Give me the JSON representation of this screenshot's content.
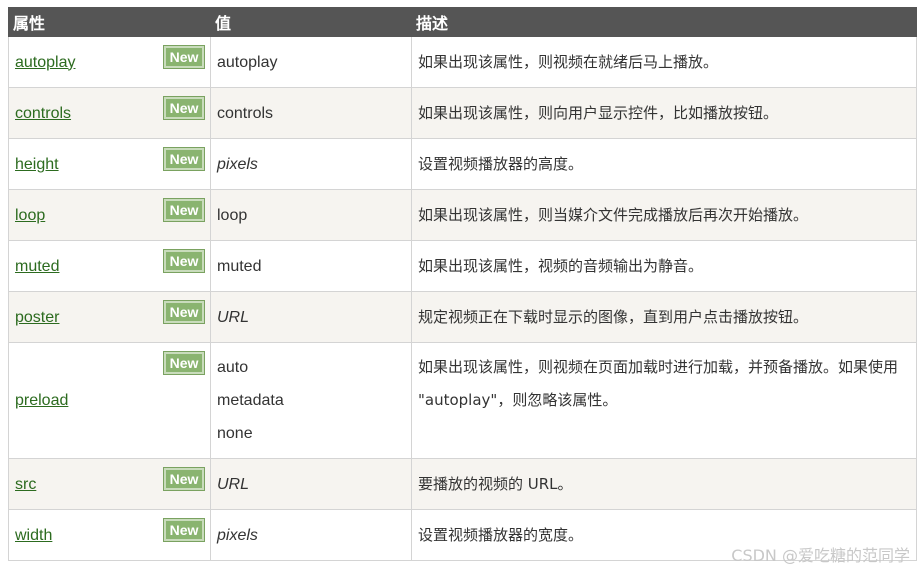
{
  "header": {
    "col_attribute": "属性",
    "col_value": "值",
    "col_description": "描述"
  },
  "badge_label": "New",
  "rows": [
    {
      "name": "autoplay",
      "values": [
        "autoplay"
      ],
      "italic": false,
      "description": "如果出现该属性，则视频在就绪后马上播放。"
    },
    {
      "name": "controls",
      "values": [
        "controls"
      ],
      "italic": false,
      "description": "如果出现该属性，则向用户显示控件，比如播放按钮。"
    },
    {
      "name": "height",
      "values": [
        "pixels"
      ],
      "italic": true,
      "description": "设置视频播放器的高度。"
    },
    {
      "name": "loop",
      "values": [
        "loop"
      ],
      "italic": false,
      "description": "如果出现该属性，则当媒介文件完成播放后再次开始播放。"
    },
    {
      "name": "muted",
      "values": [
        "muted"
      ],
      "italic": false,
      "description": "如果出现该属性，视频的音频输出为静音。"
    },
    {
      "name": "poster",
      "values": [
        "URL"
      ],
      "italic": true,
      "description": "规定视频正在下载时显示的图像，直到用户点击播放按钮。"
    },
    {
      "name": "preload",
      "values": [
        "auto",
        "metadata",
        "none"
      ],
      "italic": false,
      "description": "如果出现该属性，则视频在页面加载时进行加载，并预备播放。如果使用 \"autoplay\"，则忽略该属性。"
    },
    {
      "name": "src",
      "values": [
        "URL"
      ],
      "italic": true,
      "description": "要播放的视频的 URL。"
    },
    {
      "name": "width",
      "values": [
        "pixels"
      ],
      "italic": true,
      "description": "设置视频播放器的宽度。"
    }
  ],
  "watermark": "CSDN @爱吃糖的范同学",
  "colors": {
    "header_bg": "#555555",
    "link": "#2c6b1f",
    "badge_bg": "#8ab470",
    "row_alt_bg": "#f6f4f0"
  }
}
